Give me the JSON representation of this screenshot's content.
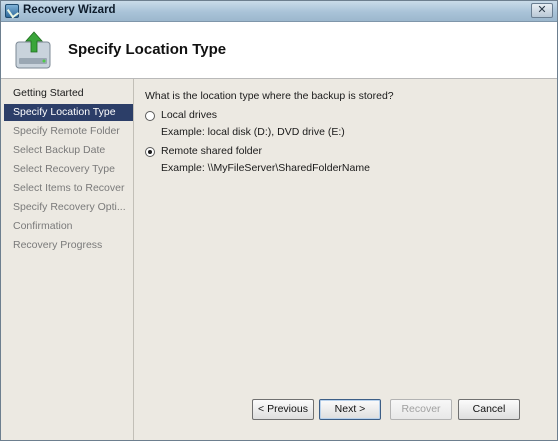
{
  "window": {
    "title": "Recovery Wizard"
  },
  "header": {
    "heading": "Specify Location Type"
  },
  "steps": [
    {
      "label": "Getting Started"
    },
    {
      "label": "Specify Location Type"
    },
    {
      "label": "Specify Remote Folder"
    },
    {
      "label": "Select Backup Date"
    },
    {
      "label": "Select Recovery Type"
    },
    {
      "label": "Select Items to Recover"
    },
    {
      "label": "Specify Recovery Opti..."
    },
    {
      "label": "Confirmation"
    },
    {
      "label": "Recovery Progress"
    }
  ],
  "main": {
    "question": "What is the location type where the backup is stored?",
    "options": [
      {
        "label": "Local drives",
        "example": "Example: local disk (D:), DVD drive (E:)",
        "selected": false
      },
      {
        "label": "Remote shared folder",
        "example": "Example: \\\\MyFileServer\\SharedFolderName",
        "selected": true
      }
    ]
  },
  "buttons": {
    "previous": "< Previous",
    "next": "Next >",
    "recover": "Recover",
    "cancel": "Cancel"
  },
  "colors": {
    "active_step_bg": "#2c3e68",
    "dialog_bg": "#ece9e2"
  },
  "icons": [
    "recovery-wizard-icon",
    "close-icon",
    "backup-drive-icon"
  ]
}
